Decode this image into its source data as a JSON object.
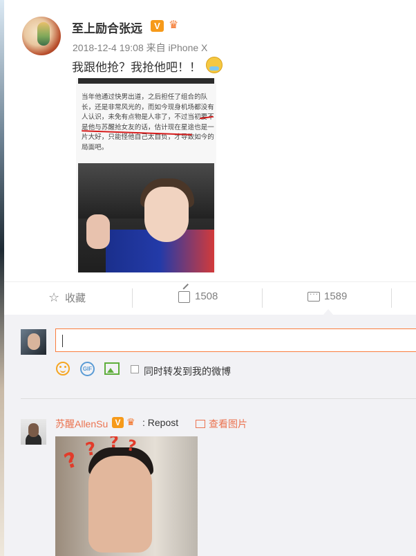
{
  "post": {
    "username": "至上励合张远",
    "verified_badge": "V",
    "timestamp": "2018-12-4 19:08",
    "source": "来自 iPhone X",
    "text": "我跟他抢？我抢他吧！！"
  },
  "quote_image": {
    "text": "当年他通过快男出道，之后担任了组合的队长，还是非常风光的，而如今现身机场都没有人认识，未免有点物是人非了，不过当初要不是他与苏醒抢女友的话，估计现在星途也是一片大好，只能怪他自己太自负，才导致如今的局面吧。"
  },
  "actions": {
    "favorite": {
      "label": "收藏",
      "icon": "star-icon"
    },
    "repost": {
      "count": "1508",
      "icon": "share-icon"
    },
    "comment": {
      "count": "1589",
      "icon": "comment-icon"
    }
  },
  "composer": {
    "input_value": "",
    "forward_label": "同时转发到我的微博",
    "forward_checked": false,
    "icons": [
      "smile-icon",
      "gif-icon",
      "image-icon"
    ]
  },
  "reply": {
    "username": "苏醒AllenSu",
    "verified_badge": "V",
    "text": ": Repost",
    "view_image_label": "查看图片"
  },
  "colors": {
    "accent": "#eb7350",
    "input_focus_border": "#fa7d3c",
    "badge_orange": "#f69a1a",
    "underline_red": "#d61a1a"
  }
}
